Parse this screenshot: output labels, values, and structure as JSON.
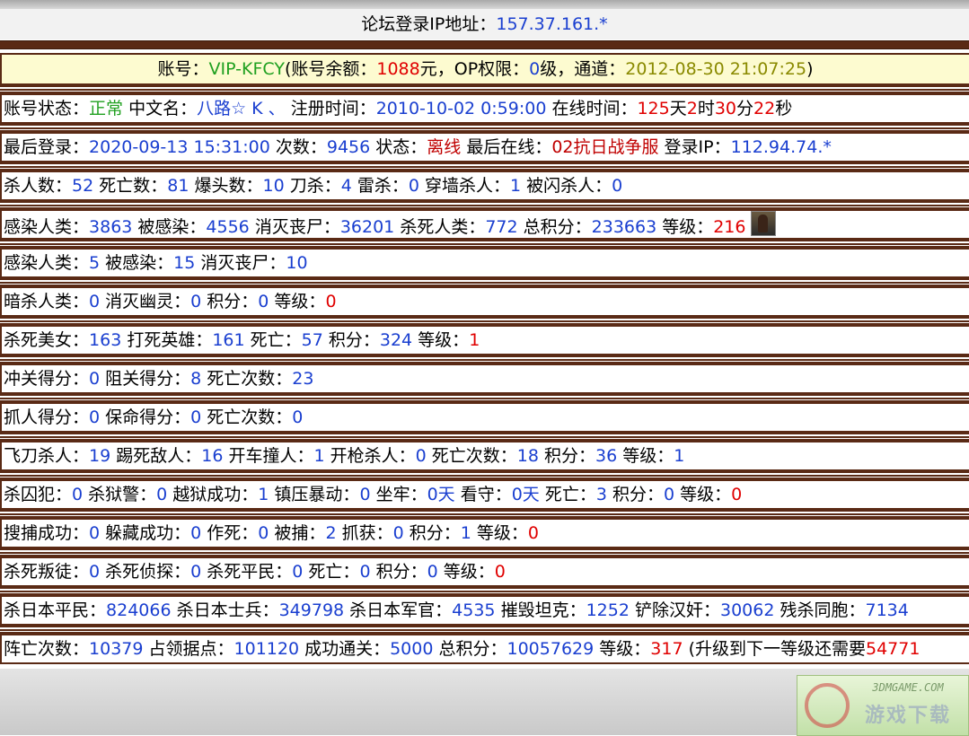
{
  "header": {
    "ip_label": "论坛登录IP地址：",
    "ip_value": "157.37.161.*"
  },
  "account": {
    "label": "账号：",
    "id": "VIP-KFCY",
    "balance_label": "(账号余额：",
    "balance": "1088",
    "balance_unit": "元，OP权限：",
    "op_level": "0",
    "op_unit": "级，通道：",
    "channel_time": "2012-08-30 21:07:25",
    "close": ")"
  },
  "status_row": {
    "status_label": "账号状态：",
    "status": "正常",
    "cn_name_label": " 中文名：",
    "cn_name": "八路☆ K 、",
    "reg_label": " 注册时间：",
    "reg_time": "2010-10-02 0:59:00",
    "online_label": " 在线时间：",
    "days": "125",
    "d_unit": "天",
    "hours": "2",
    "h_unit": "时",
    "minutes": "30",
    "m_unit": "分",
    "seconds": "22",
    "s_unit": "秒"
  },
  "login_row": {
    "last_login_label": "最后登录：",
    "last_login": "2020-09-13 15:31:00",
    "count_label": " 次数：",
    "count": "9456",
    "state_label": " 状态：",
    "state": "离线",
    "last_online_label": " 最后在线：",
    "last_online": "02抗日战争服",
    "login_ip_label": " 登录IP：",
    "login_ip": "112.94.74.*"
  },
  "row3": {
    "l1": "杀人数：",
    "v1": "52",
    "l2": " 死亡数：",
    "v2": "81",
    "l3": " 爆头数：",
    "v3": "10",
    "l4": " 刀杀：",
    "v4": "4",
    "l5": " 雷杀：",
    "v5": "0",
    "l6": " 穿墙杀人：",
    "v6": "1",
    "l7": " 被闪杀人：",
    "v7": "0"
  },
  "row4": {
    "l1": "感染人类：",
    "v1": "3863",
    "l2": " 被感染：",
    "v2": "4556",
    "l3": " 消灭丧尸：",
    "v3": "36201",
    "l4": " 杀死人类：",
    "v4": "772",
    "l5": " 总积分：",
    "v5": "233663",
    "l6": " 等级：",
    "v6": "216"
  },
  "row5": {
    "l1": "感染人类：",
    "v1": "5",
    "l2": " 被感染：",
    "v2": "15",
    "l3": " 消灭丧尸：",
    "v3": "10"
  },
  "row6": {
    "l1": "暗杀人类：",
    "v1": "0",
    "l2": " 消灭幽灵：",
    "v2": "0",
    "l3": " 积分：",
    "v3": "0",
    "l4": " 等级：",
    "v4": "0"
  },
  "row7": {
    "l1": "杀死美女：",
    "v1": "163",
    "l2": " 打死英雄：",
    "v2": "161",
    "l3": " 死亡：",
    "v3": "57",
    "l4": " 积分：",
    "v4": "324",
    "l5": " 等级：",
    "v5": "1"
  },
  "row8": {
    "l1": "冲关得分：",
    "v1": "0",
    "l2": " 阻关得分：",
    "v2": "8",
    "l3": " 死亡次数：",
    "v3": "23"
  },
  "row9": {
    "l1": "抓人得分：",
    "v1": "0",
    "l2": " 保命得分：",
    "v2": "0",
    "l3": " 死亡次数：",
    "v3": "0"
  },
  "row10": {
    "l1": "飞刀杀人：",
    "v1": "19",
    "l2": " 踢死敌人：",
    "v2": "16",
    "l3": " 开车撞人：",
    "v3": "1",
    "l4": " 开枪杀人：",
    "v4": "0",
    "l5": " 死亡次数：",
    "v5": "18",
    "l6": " 积分：",
    "v6": "36",
    "l7": " 等级：",
    "v7": "1"
  },
  "row11": {
    "l1": "杀囚犯：",
    "v1": "0",
    "l2": " 杀狱警：",
    "v2": "0",
    "l3": " 越狱成功：",
    "v3": "1",
    "l4": " 镇压暴动：",
    "v4": "0",
    "l5": " 坐牢：",
    "v5": "0天",
    "l6": " 看守：",
    "v6": "0天",
    "l7": " 死亡：",
    "v7": "3",
    "l8": " 积分：",
    "v8": "0",
    "l9": " 等级：",
    "v9": "0"
  },
  "row12": {
    "l1": "搜捕成功：",
    "v1": "0",
    "l2": " 躲藏成功：",
    "v2": "0",
    "l3": " 作死：",
    "v3": "0",
    "l4": " 被捕：",
    "v4": "2",
    "l5": " 抓获：",
    "v5": "0",
    "l6": " 积分：",
    "v6": "1",
    "l7": " 等级：",
    "v7": "0"
  },
  "row13": {
    "l1": "杀死叛徒：",
    "v1": "0",
    "l2": " 杀死侦探：",
    "v2": "0",
    "l3": " 杀死平民：",
    "v3": "0",
    "l4": " 死亡：",
    "v4": "0",
    "l5": " 积分：",
    "v5": "0",
    "l6": " 等级：",
    "v6": "0"
  },
  "row14": {
    "l1": "杀日本平民：",
    "v1": "824066",
    "l2": " 杀日本士兵：",
    "v2": "349798",
    "l3": " 杀日本军官：",
    "v3": "4535",
    "l4": " 摧毁坦克：",
    "v4": "1252",
    "l5": " 铲除汉奸：",
    "v5": "30062",
    "l6": " 残杀同胞：",
    "v6": "7134"
  },
  "row15": {
    "l1": "阵亡次数：",
    "v1": "10379",
    "l2": " 占领据点：",
    "v2": "101120",
    "l3": " 成功通关：",
    "v3": "5000",
    "l4": " 总积分：",
    "v4": "10057629",
    "l5": " 等级：",
    "v5": "317",
    "l6": " (升级到下一等级还需要",
    "v6": "54771"
  },
  "watermark": {
    "site": "3DMGAME.COM",
    "brand": "游戏下载"
  },
  "colors": {
    "border_brown": "#5a2a15",
    "value_blue": "#1a3fd0",
    "value_red": "#e00000",
    "value_green": "#20a020",
    "account_bg": "#fdfbd0"
  }
}
